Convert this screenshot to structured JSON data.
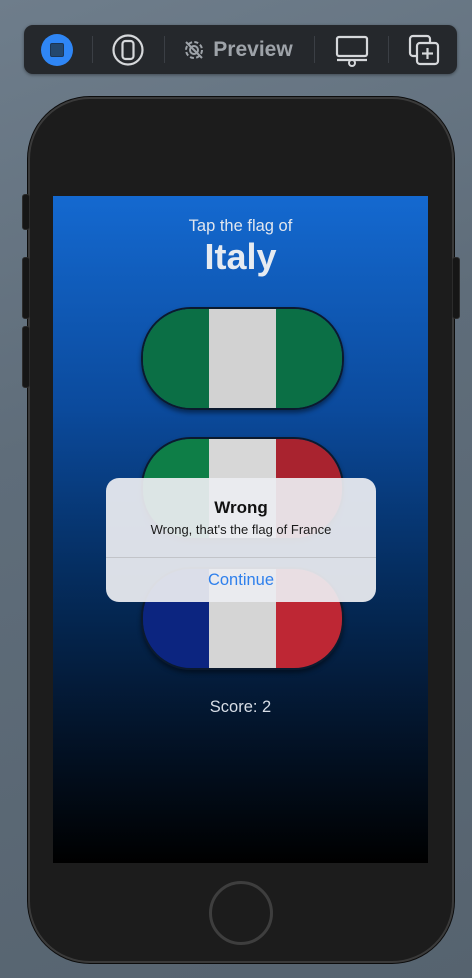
{
  "toolbar": {
    "preview_label": "Preview",
    "icons": [
      "live-preview-icon",
      "device-icon",
      "preview-settings-icon",
      "display-icon",
      "duplicate-icon"
    ],
    "accent": "#2f86f5"
  },
  "game": {
    "prompt": "Tap the flag of",
    "country": "Italy",
    "score_text": "Score: 2",
    "flags": [
      {
        "name": "Italy",
        "colors": [
          "#0b6f45",
          "#d2d2d2",
          "#0b6f45"
        ]
      },
      {
        "name": "Italy",
        "colors": [
          "#0e7e47",
          "#d7d7d7",
          "#a9232f"
        ]
      },
      {
        "name": "France",
        "colors": [
          "#0c2580",
          "#d5d5d5",
          "#be2734"
        ]
      }
    ]
  },
  "alert": {
    "title": "Wrong",
    "message": "Wrong, that's the flag of France",
    "button": "Continue"
  }
}
